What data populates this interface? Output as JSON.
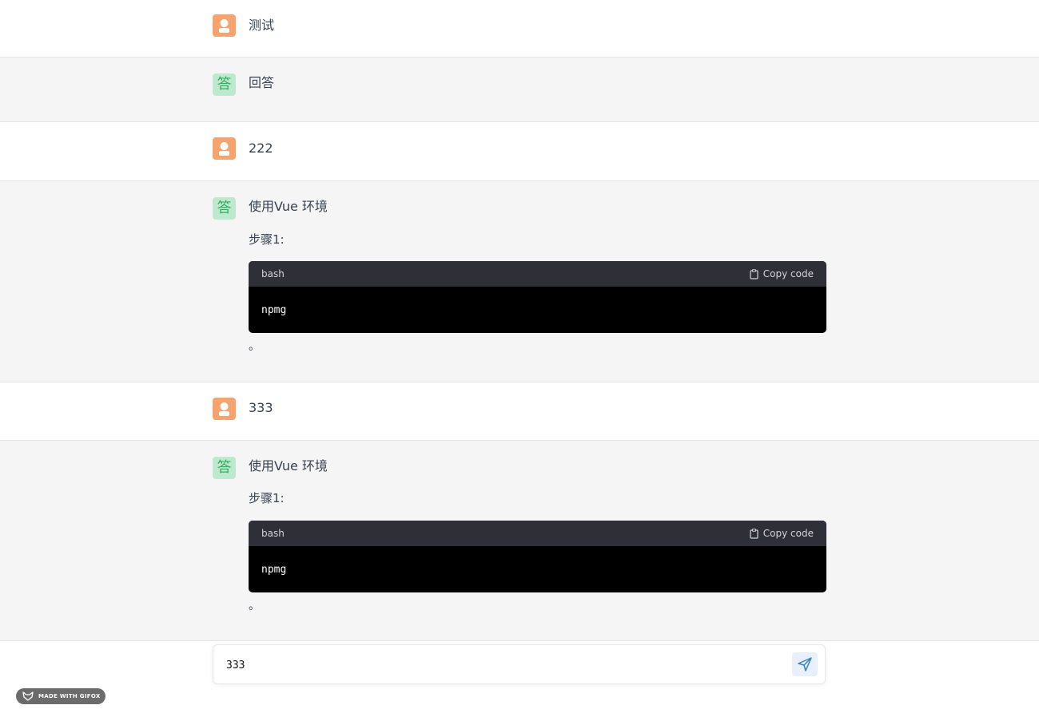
{
  "conversation": [
    {
      "role": "user",
      "text": "测试"
    },
    {
      "role": "assistant",
      "text": "回答"
    },
    {
      "role": "user",
      "text": "222"
    },
    {
      "role": "assistant",
      "text": "使用Vue 环境",
      "step": "步骤1:",
      "code_lang": "bash",
      "copy_label": "Copy code",
      "code": "npmg",
      "tail": "。"
    },
    {
      "role": "user",
      "text": "333"
    },
    {
      "role": "assistant",
      "text": "使用Vue 环境",
      "step": "步骤1:",
      "code_lang": "bash",
      "copy_label": "Copy code",
      "code": "npmg",
      "tail": "。"
    }
  ],
  "assistant_avatar_char": "答",
  "input": {
    "value": "333"
  },
  "badge": {
    "text": "MADE WITH GIFOX"
  },
  "colors": {
    "user_avatar": "#f7a36d",
    "assistant_avatar": "#bfe9cf",
    "code_bg": "#000000",
    "code_header": "#2f2f37",
    "send_button": "#e7f0fb"
  }
}
